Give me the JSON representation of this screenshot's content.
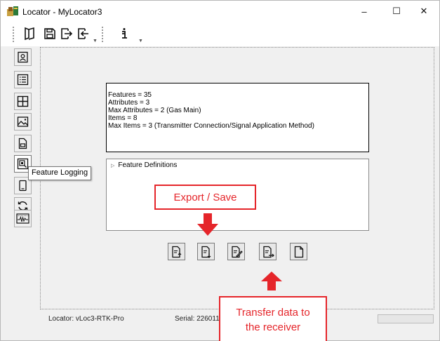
{
  "window": {
    "title": "Locator - MyLocator3",
    "controls": {
      "minimize": "–",
      "maximize": "☐",
      "close": "✕"
    }
  },
  "toolbar": {
    "buttons": [
      "open-book-icon",
      "save-icon",
      "export-icon",
      "import-icon",
      "info-icon"
    ]
  },
  "nav": {
    "buttons": [
      "contact-card-icon",
      "list-icon",
      "grid-icon",
      "image-icon",
      "document-icon",
      "feature-logging-icon",
      "phone-icon",
      "sync-icon",
      "signal-icon"
    ],
    "active": "feature-logging-icon",
    "tooltip": "Feature Logging"
  },
  "summary": {
    "lines": [
      "Features = 35",
      "Attributes = 3",
      "Max Attributes = 2 (Gas Main)",
      "Items = 8",
      "Max Items = 3 (Transmitter Connection/Signal Application Method)"
    ]
  },
  "definitions": {
    "label": "Feature Definitions"
  },
  "actions": [
    "export-up-icon",
    "export-down-icon",
    "edit-icon",
    "transfer-icon",
    "new-document-icon"
  ],
  "status": {
    "locator": "Locator: vLoc3-RTK-Pro",
    "serial": "Serial: 226011"
  },
  "annotations": {
    "export_label": "Export / Save",
    "transfer_label_line1": "Transfer data to",
    "transfer_label_line2": "the receiver",
    "color": "#e5252a"
  }
}
